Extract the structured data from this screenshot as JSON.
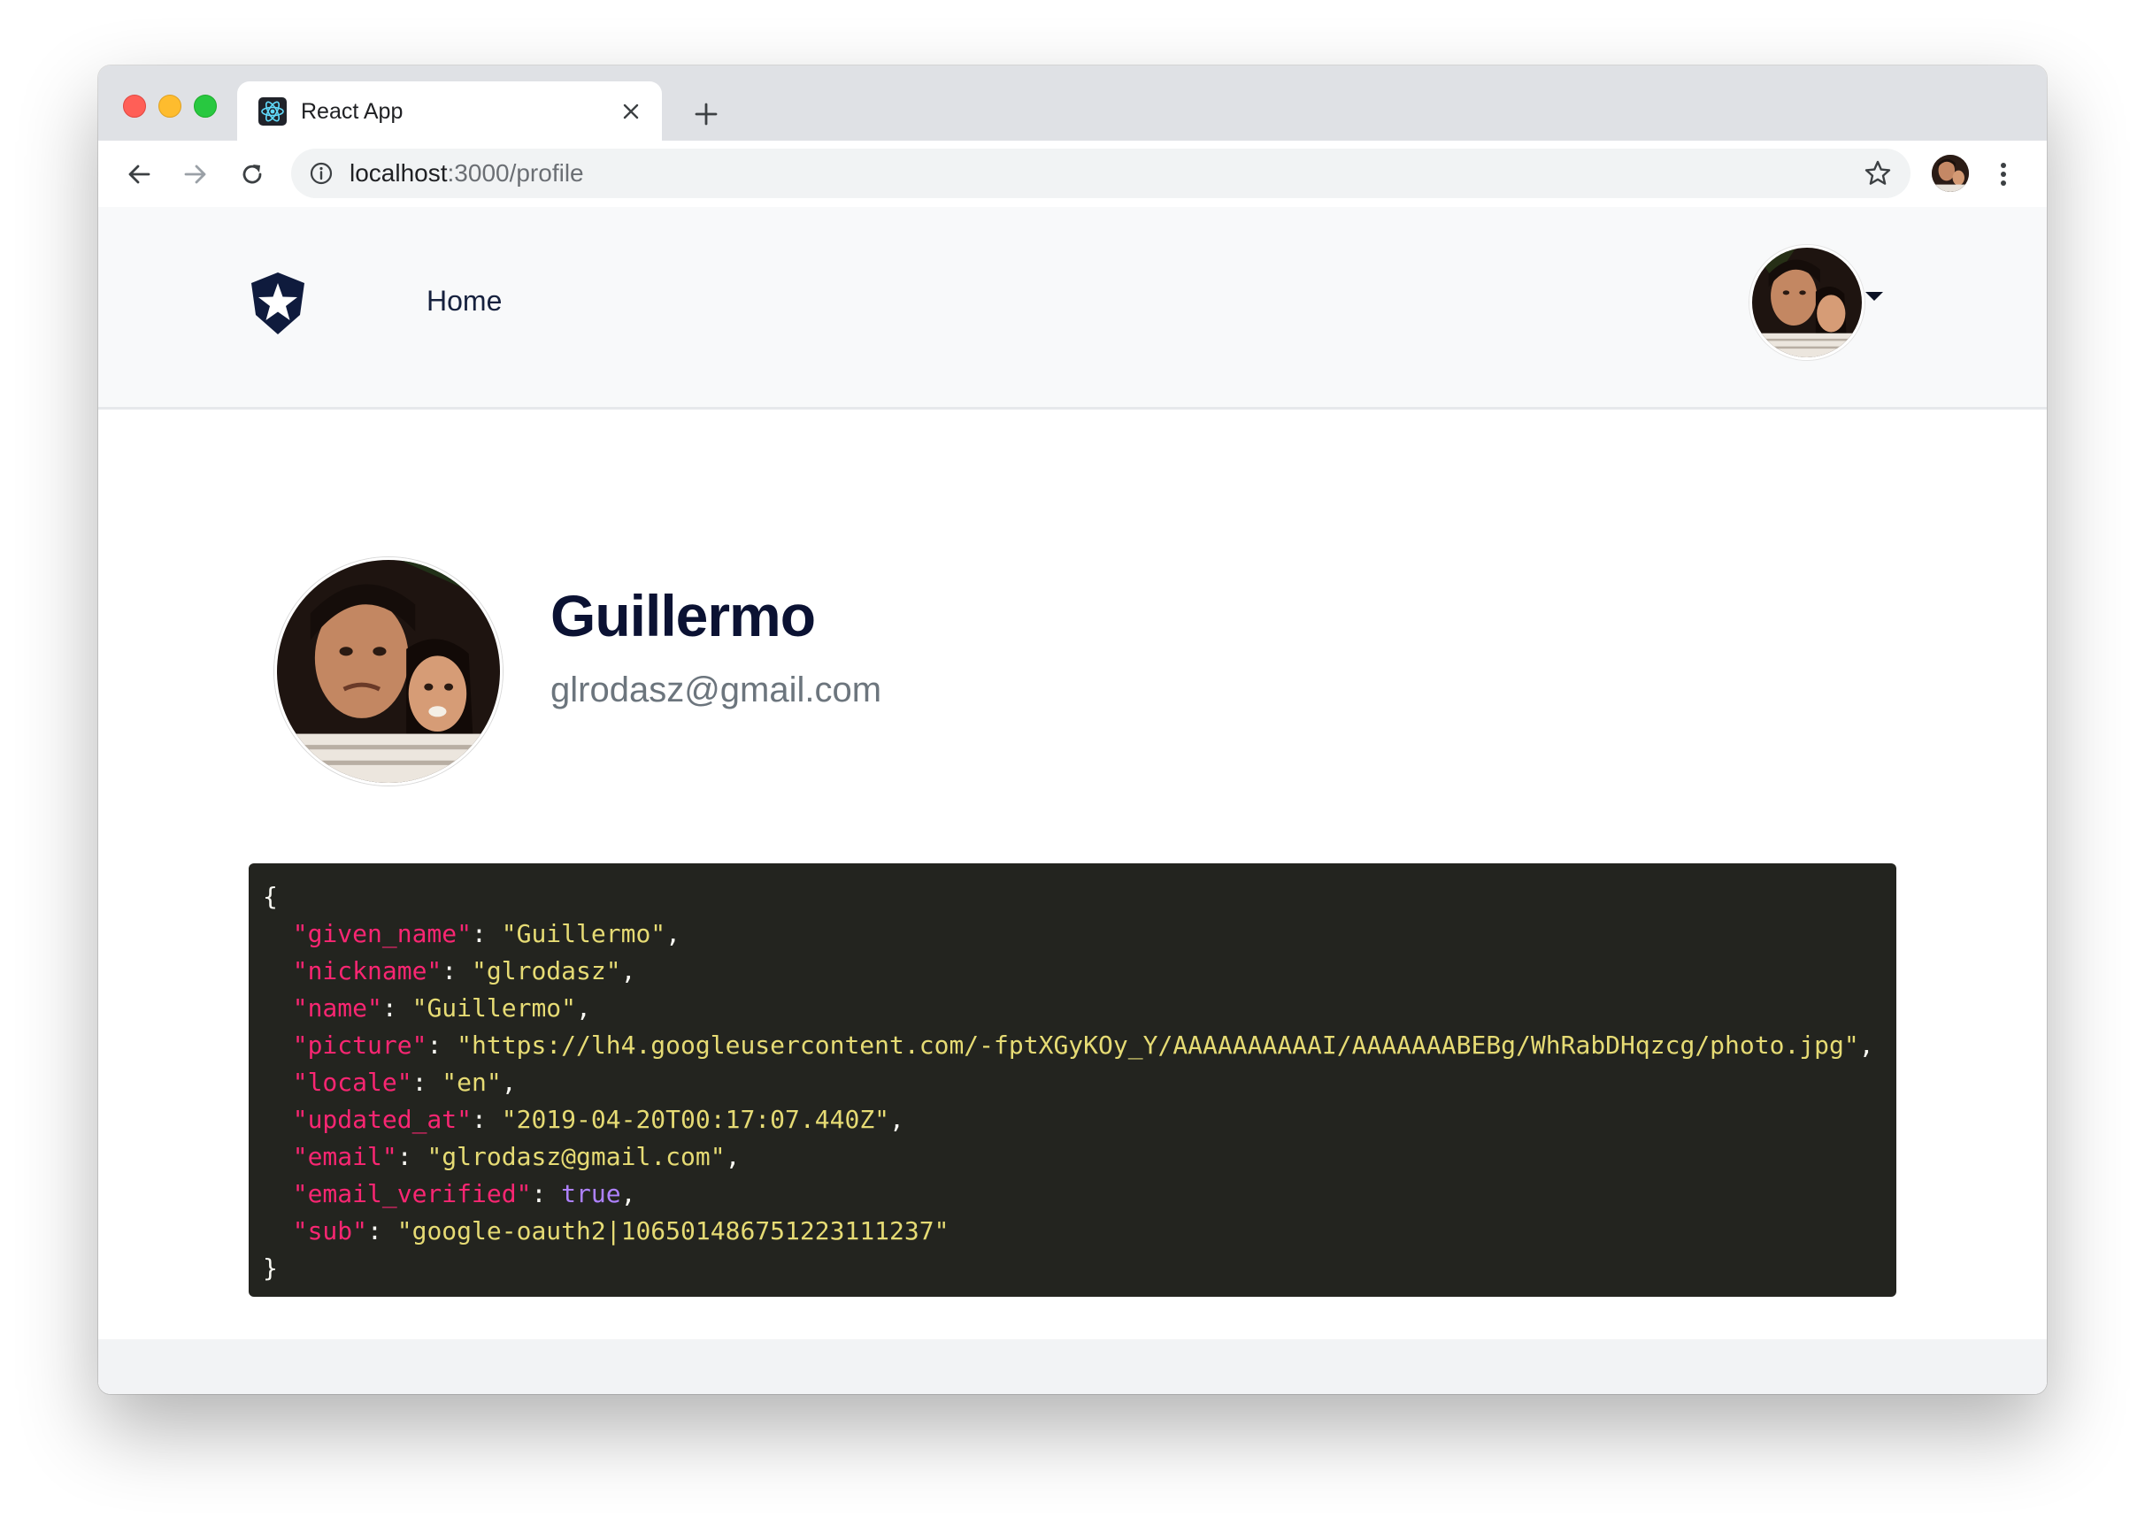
{
  "browser": {
    "tab_title": "React App",
    "url_host": "localhost",
    "url_path": ":3000/profile",
    "icons": [
      "react-logo-icon",
      "close-icon",
      "plus-icon",
      "back-arrow-icon",
      "forward-arrow-icon",
      "reload-icon",
      "info-icon",
      "star-icon",
      "kebab-menu-icon"
    ]
  },
  "navbar": {
    "home_label": "Home",
    "logo": "shield-star-icon"
  },
  "profile": {
    "name": "Guillermo",
    "email": "glrodasz@gmail.com"
  },
  "json_dump": {
    "open_brace": "{",
    "close_brace": "}",
    "entries": [
      {
        "key": "\"given_name\"",
        "value": "\"Guillermo\"",
        "type": "string",
        "comma": ","
      },
      {
        "key": "\"nickname\"",
        "value": "\"glrodasz\"",
        "type": "string",
        "comma": ","
      },
      {
        "key": "\"name\"",
        "value": "\"Guillermo\"",
        "type": "string",
        "comma": ","
      },
      {
        "key": "\"picture\"",
        "value": "\"https://lh4.googleusercontent.com/-fptXGyKOy_Y/AAAAAAAAAAI/AAAAAAABEBg/WhRabDHqzcg/photo.jpg\"",
        "type": "string",
        "comma": ","
      },
      {
        "key": "\"locale\"",
        "value": "\"en\"",
        "type": "string",
        "comma": ","
      },
      {
        "key": "\"updated_at\"",
        "value": "\"2019-04-20T00:17:07.440Z\"",
        "type": "string",
        "comma": ","
      },
      {
        "key": "\"email\"",
        "value": "\"glrodasz@gmail.com\"",
        "type": "string",
        "comma": ","
      },
      {
        "key": "\"email_verified\"",
        "value": "true",
        "type": "boolean",
        "comma": ","
      },
      {
        "key": "\"sub\"",
        "value": "\"google-oauth2|106501486751223111237\"",
        "type": "string",
        "comma": ""
      }
    ]
  },
  "colors": {
    "code_bg": "#23241f",
    "json_key": "#f92672",
    "json_string": "#e6db74",
    "json_boolean": "#ae81ff",
    "heading": "#0b1233",
    "muted": "#6c757d"
  }
}
